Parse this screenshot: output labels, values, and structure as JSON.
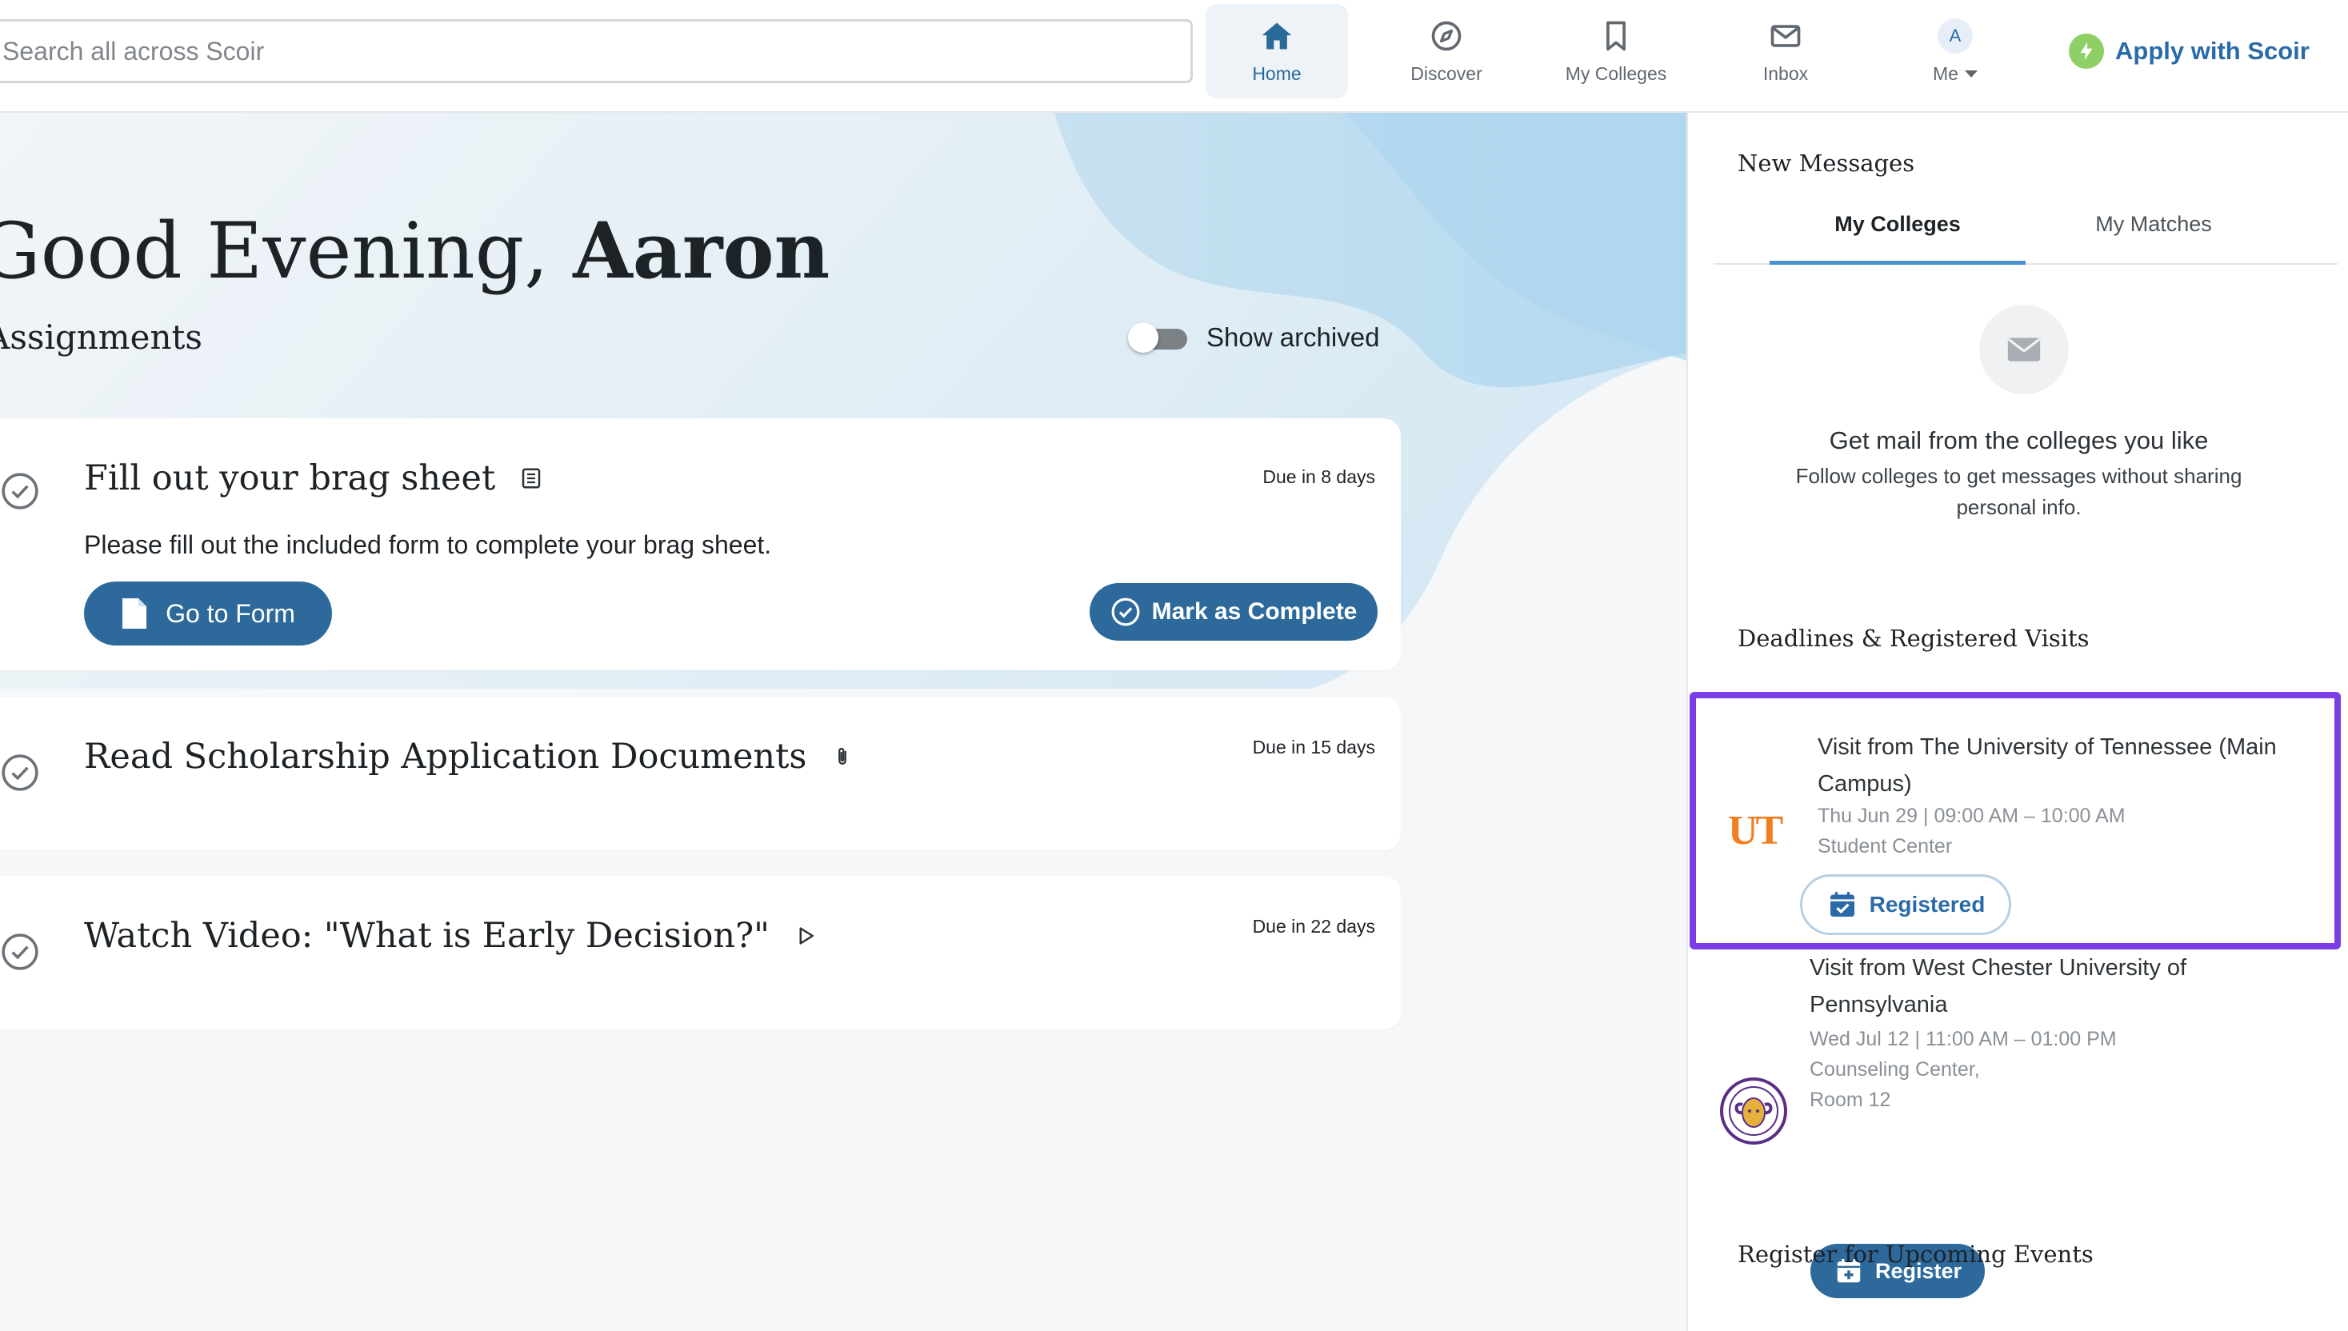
{
  "search": {
    "placeholder": "Search all across Scoir"
  },
  "nav": {
    "home": "Home",
    "discover": "Discover",
    "my_colleges": "My Colleges",
    "inbox": "Inbox",
    "me": "Me",
    "avatar_initial": "A"
  },
  "apply_link": "Apply with Scoir",
  "greeting": {
    "prefix": "Good Evening, ",
    "name": "Aaron"
  },
  "assignments": {
    "heading": "Assignments",
    "show_archived": "Show archived",
    "items": [
      {
        "title": "Fill out your brag sheet",
        "due": "Due in 8 days",
        "description": "Please fill out the included form to complete your brag sheet.",
        "primary_action": "Go to Form",
        "complete_action": "Mark as Complete",
        "icon": "form-list-icon"
      },
      {
        "title": "Read Scholarship Application Documents",
        "due": "Due in 15 days",
        "icon": "paperclip-icon"
      },
      {
        "title": "Watch Video: \"What is Early Decision?\"",
        "due": "Due in 22 days",
        "icon": "play-icon"
      }
    ]
  },
  "panel": {
    "messages_heading": "New Messages",
    "tabs": [
      "My Colleges",
      "My Matches"
    ],
    "active_tab": "My Colleges",
    "empty_title": "Get mail from the colleges you like",
    "empty_subtitle": "Follow colleges to get messages without sharing personal info.",
    "deadlines_heading": "Deadlines & Registered Visits",
    "visits": [
      {
        "title": "Visit from The University of Tennessee (Main Campus)",
        "when": "Thu Jun 29 | 09:00 AM – 10:00 AM",
        "where": "Student Center",
        "status": "Registered",
        "logo_text": "UT"
      },
      {
        "title": "Visit from West Chester University of Pennsylvania",
        "when": "Wed Jul 12 | 11:00 AM – 01:00 PM",
        "where": "Counseling Center, Room 12",
        "action": "Register"
      }
    ],
    "events_heading": "Register for Upcoming Events"
  },
  "colors": {
    "primary": "#2d6a9b",
    "accent_blue": "#2a6aa8",
    "highlight_border": "#7b3ee6",
    "ut_orange": "#f07f21",
    "bolt_green": "#8ed066"
  }
}
